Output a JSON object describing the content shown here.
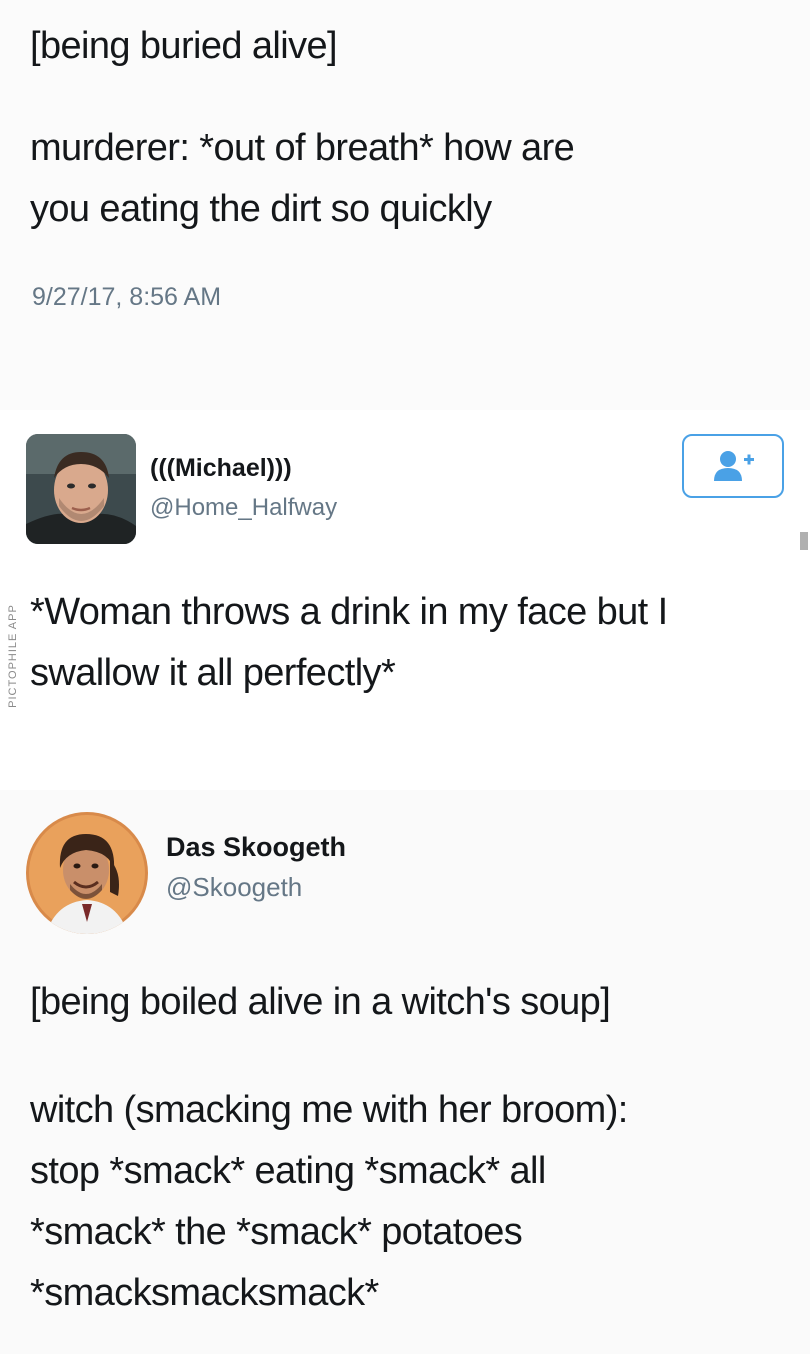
{
  "tweet_top": {
    "line_scene": "[being buried alive]",
    "line_dialogue": "murderer: *out of breath* how are\nyou eating the dirt so quickly",
    "timestamp": "9/27/17, 8:56 AM"
  },
  "tweet_middle": {
    "display_name": "(((Michael)))",
    "handle": "@Home_Halfway",
    "follow_icon": "add-user-icon",
    "text": "*Woman throws a drink in my face but I\nswallow it all perfectly*"
  },
  "watermark": "PICTOPHILE APP",
  "tweet_bottom": {
    "display_name": "Das Skoogeth",
    "handle": "@Skoogeth",
    "line_scene": "[being boiled alive in a witch's soup]",
    "line_dialogue": "witch (smacking me with her broom):\nstop *smack* eating *smack* all\n*smack* the *smack* potatoes\n*smacksmacksmack*"
  },
  "colors": {
    "text": "#14171a",
    "secondary": "#657786",
    "follow_accent": "#4aa1e6"
  }
}
